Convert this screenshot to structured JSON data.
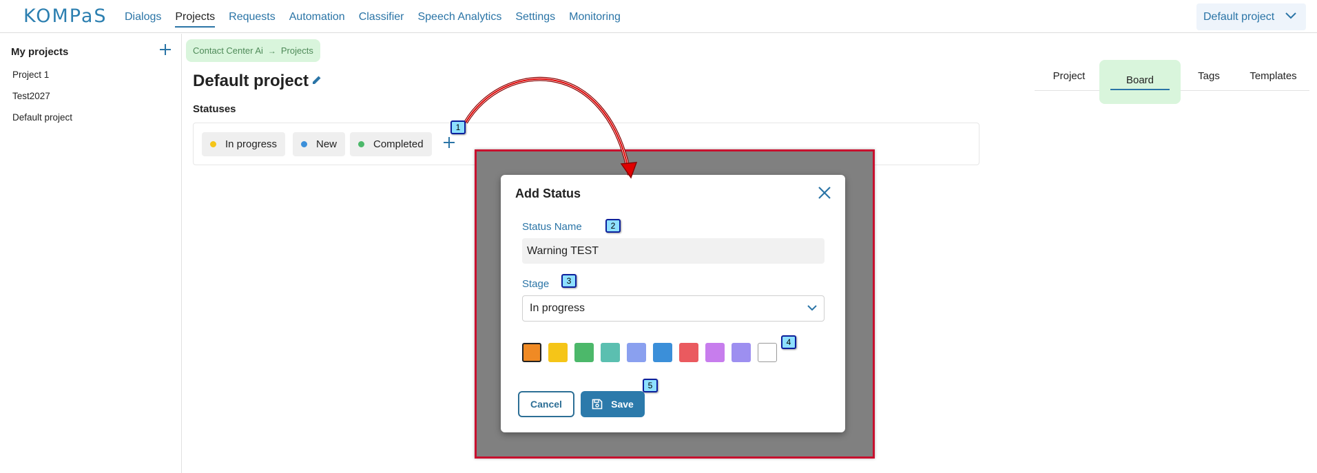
{
  "app": {
    "logo": "KOMPaS"
  },
  "nav": {
    "items": [
      {
        "label": "Dialogs"
      },
      {
        "label": "Projects",
        "active": true
      },
      {
        "label": "Requests"
      },
      {
        "label": "Automation"
      },
      {
        "label": "Classifier"
      },
      {
        "label": "Speech Analytics"
      },
      {
        "label": "Settings"
      },
      {
        "label": "Monitoring"
      }
    ],
    "project_selector": "Default project"
  },
  "sidebar": {
    "title": "My projects",
    "items": [
      {
        "label": "Project 1"
      },
      {
        "label": "Test2027"
      },
      {
        "label": "Default project"
      }
    ]
  },
  "breadcrumb": {
    "root": "Contact Center Ai",
    "arrow": "→",
    "current": "Projects"
  },
  "page": {
    "title": "Default project",
    "statuses_label": "Statuses"
  },
  "statuses": [
    {
      "label": "In progress",
      "color": "#f5c518"
    },
    {
      "label": "New",
      "color": "#3b8fd9"
    },
    {
      "label": "Completed",
      "color": "#4cb86a"
    }
  ],
  "tabs": [
    {
      "label": "Project"
    },
    {
      "label": "Board",
      "active": true
    },
    {
      "label": "Tags"
    },
    {
      "label": "Templates"
    }
  ],
  "dialog": {
    "title": "Add Status",
    "status_name_label": "Status Name",
    "status_name_value": "Warning TEST",
    "stage_label": "Stage",
    "stage_value": "In progress",
    "colors": [
      "#f08a24",
      "#f5c518",
      "#4cb86a",
      "#5bbfb0",
      "#8aa0ef",
      "#3b8fd9",
      "#ea5a5f",
      "#c77ded",
      "#9d8ff0",
      "#ffffff"
    ],
    "selected_color": "#f08a24",
    "cancel_label": "Cancel",
    "save_label": "Save"
  },
  "markers": [
    "1",
    "2",
    "3",
    "4",
    "5"
  ],
  "colors": {
    "accent": "#2a74a6",
    "highlight": "#d9f5dc",
    "annotation_border": "#c8102e"
  }
}
